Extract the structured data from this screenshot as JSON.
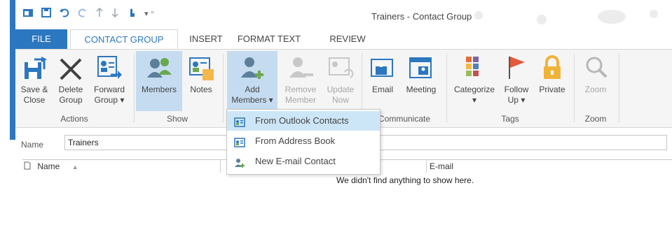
{
  "window": {
    "title": "Trainers - Contact Group"
  },
  "tabs": [
    {
      "label": "FILE"
    },
    {
      "label": "CONTACT GROUP"
    },
    {
      "label": "INSERT"
    },
    {
      "label": "FORMAT TEXT"
    },
    {
      "label": "REVIEW"
    }
  ],
  "ribbon": {
    "actions": {
      "label": "Actions",
      "save": [
        "Save &",
        "Close"
      ],
      "delete": [
        "Delete",
        "Group"
      ],
      "forward": [
        "Forward",
        "Group ▾"
      ]
    },
    "show": {
      "label": "Show",
      "members": "Members",
      "notes": "Notes"
    },
    "members": {
      "add": [
        "Add",
        "Members ▾"
      ],
      "remove": [
        "Remove",
        "Member"
      ],
      "update": [
        "Update",
        "Now"
      ]
    },
    "communicate": {
      "label": "Communicate",
      "email": "Email",
      "meeting": "Meeting"
    },
    "tags": {
      "label": "Tags",
      "categorize": "Categorize",
      "categorize_arrow": "▾",
      "follow": [
        "Follow",
        "Up ▾"
      ],
      "private": "Private"
    },
    "zoom": {
      "label": "Zoom",
      "zoom": "Zoom"
    }
  },
  "dropdown": {
    "items": [
      {
        "label": "From Outlook Contacts"
      },
      {
        "label": "From Address Book"
      },
      {
        "label": "New E-mail Contact"
      }
    ]
  },
  "form": {
    "name_label": "Name",
    "name_value": "Trainers"
  },
  "table": {
    "columns": [
      "Name",
      "E-mail"
    ],
    "empty_message": "We didn't find anything to show here."
  }
}
